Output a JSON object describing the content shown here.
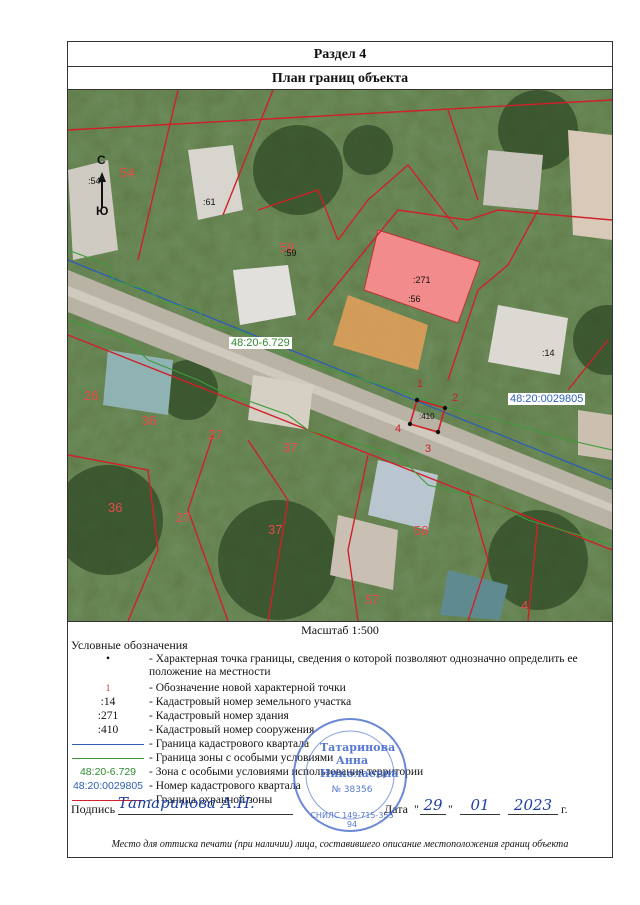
{
  "section_title": "Раздел 4",
  "plan_title": "План границ объекта",
  "compass": {
    "north": "С",
    "south": "Ю"
  },
  "map_labels": {
    "plots": [
      "54",
      "61",
      "59",
      "26",
      "36",
      "27",
      "37",
      "36",
      "27",
      "37",
      "58",
      "57",
      "4"
    ],
    "numbers": [
      ":54",
      ":61",
      ":59",
      ":271",
      ":56",
      ":14",
      ":410"
    ],
    "points": [
      "1",
      "2",
      "3",
      "4"
    ],
    "zone": "48:20-6.729",
    "quarter": "48:20:0029805"
  },
  "scale": "Масштаб 1:500",
  "legend_title": "Условные обозначения",
  "legend": [
    {
      "symbol": "•",
      "text": "- Характерная точка границы, сведения о которой позволяют однозначно определить ее положение на местности"
    },
    {
      "symbol": "1",
      "text": "- Обозначение новой характерной точки"
    },
    {
      "symbol": ":14",
      "text": "- Кадастровый номер земельного участка"
    },
    {
      "symbol": ":271",
      "text": "- Кадастровый номер здания"
    },
    {
      "symbol": ":410",
      "text": "- Кадастровый номер сооружения"
    },
    {
      "symbol": "",
      "text": "- Граница кадастрового квартала"
    },
    {
      "symbol": "",
      "text": "- Граница зоны с особыми условиями"
    },
    {
      "symbol": "48:20-6.729",
      "text": "- Зона с особыми условиями использования территории"
    },
    {
      "symbol": "48:20:0029805",
      "text": "- Номер кадастрового квартала"
    },
    {
      "symbol": "",
      "text": "- Граница охранной зоны"
    }
  ],
  "colors": {
    "quarter_line": "#2c5fb5",
    "zone_line": "#3f9a3a",
    "protect_line": "#d0202a",
    "point_red": "#d0202a",
    "zone_text": "#2e8b2e",
    "quarter_text": "#2c5fb5"
  },
  "signature": {
    "label": "Подпись",
    "name_scrawl": "Татаринова А.Н.",
    "date_label": "Дата",
    "day": "29",
    "month": "01",
    "year": "2023",
    "suffix": "г."
  },
  "stamp": {
    "name": "Татаринова Анна Николаевна",
    "reg": "№ 38356",
    "snils": "СНИЛС 149-715-355 94"
  },
  "footnote": "Место для оттиска печати (при наличии) лица, составившего описание местоположения границ объекта"
}
